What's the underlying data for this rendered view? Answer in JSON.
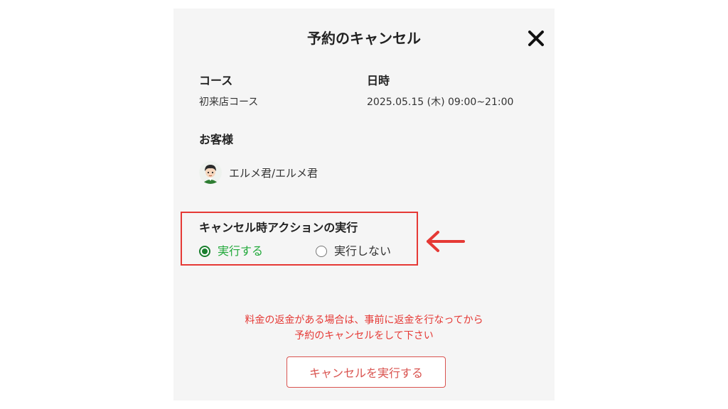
{
  "modal": {
    "title": "予約のキャンセル",
    "close_icon": "close-icon"
  },
  "course": {
    "label": "コース",
    "value": "初来店コース"
  },
  "datetime": {
    "label": "日時",
    "value": "2025.05.15 (木) 09:00~21:00"
  },
  "customer": {
    "label": "お客様",
    "name": "エルメ君/エルメ君",
    "avatar_icon": "avatar"
  },
  "cancel_action": {
    "title": "キャンセル時アクションの実行",
    "options": [
      {
        "label": "実行する",
        "selected": true
      },
      {
        "label": "実行しない",
        "selected": false
      }
    ]
  },
  "warning": {
    "line1": "料金の返金がある場合は、事前に返金を行なってから",
    "line2": "予約のキャンセルをして下さい"
  },
  "buttons": {
    "execute_cancel": "キャンセルを実行する"
  },
  "colors": {
    "highlight_border": "#e53935",
    "arrow": "#e53935",
    "selected_radio": "#1a7f2e",
    "selected_label": "#22a93b",
    "warning_text": "#e53935",
    "button_accent": "#d9534f",
    "modal_bg": "#f5f5f5"
  }
}
